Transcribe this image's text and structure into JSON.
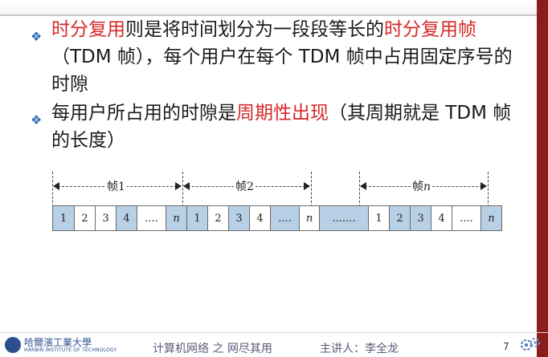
{
  "bullets": [
    {
      "segments": [
        {
          "text": "时分复用",
          "color": "red"
        },
        {
          "text": "则是将时间划分为一段段等长的",
          "color": "normal"
        },
        {
          "text": "时分复用帧",
          "color": "red"
        },
        {
          "text": "（TDM 帧），每个用户在每个 TDM 帧中占用固定序号的时隙",
          "color": "normal"
        }
      ]
    },
    {
      "segments": [
        {
          "text": "每用户所占用的时隙是",
          "color": "normal"
        },
        {
          "text": "周期性出现",
          "color": "red"
        },
        {
          "text": "（其周期就是 TDM 帧的长度）",
          "color": "normal"
        }
      ]
    }
  ],
  "diagram": {
    "frame_labels": [
      "帧1",
      "帧2",
      "帧n"
    ],
    "frame1_slots": [
      "1",
      "2",
      "3",
      "4",
      "....",
      "n"
    ],
    "frame2_slots": [
      "1",
      "2",
      "3",
      "4",
      "....",
      "n"
    ],
    "gap_label": ".......",
    "frame3_slots": [
      "1",
      "2",
      "3",
      "4",
      "....",
      "n"
    ]
  },
  "footer": {
    "university": "哈爾濱工業大學",
    "university_en": "HARBIN INSTITUTE OF TECHNOLOGY",
    "course": "计算机网络 之 网尽其用",
    "speaker": "主讲人：李全龙",
    "page": "7"
  },
  "colors": {
    "accent_red": "#d62828",
    "bullet_blue": "#2f6fb5",
    "slot_shade": "#b8d0e5",
    "sidebar": "#8b1d1d"
  }
}
